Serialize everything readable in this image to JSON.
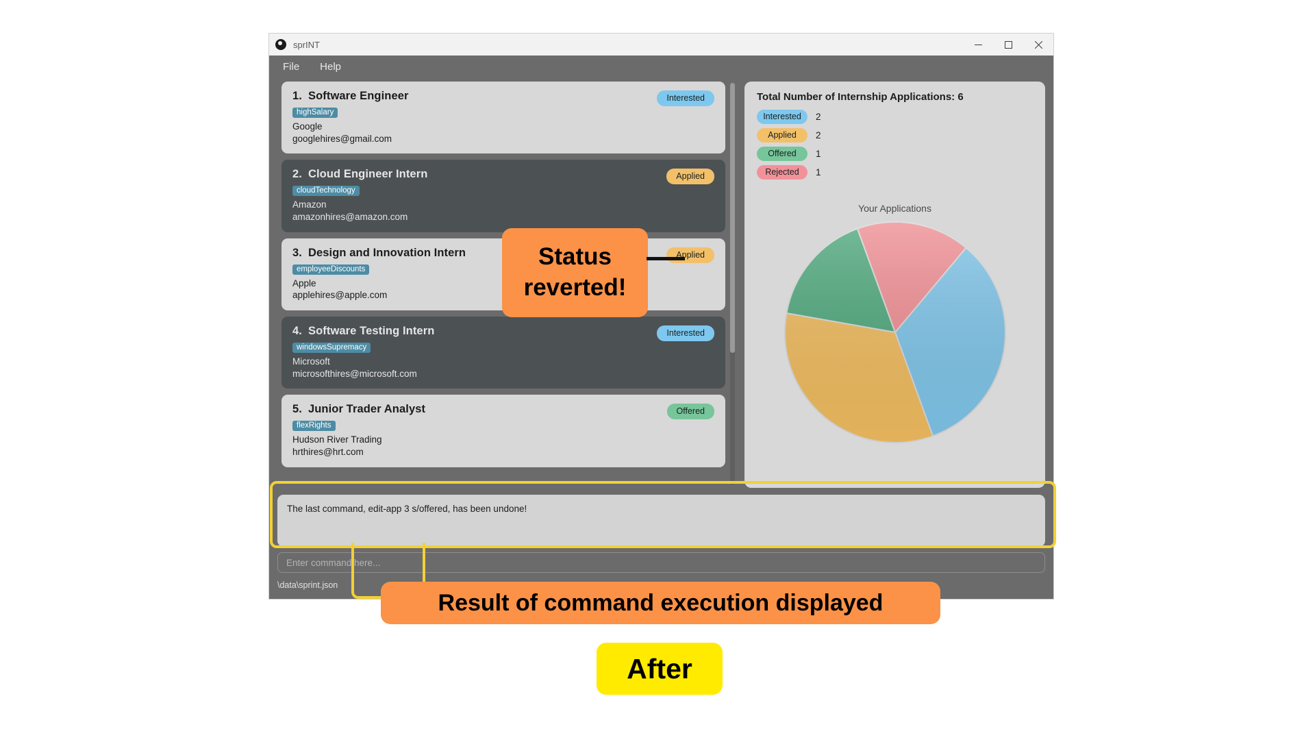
{
  "window": {
    "title": "sprINT",
    "logo_icon": "sprint-logo-icon",
    "controls": {
      "minimize": "minimize-icon",
      "maximize": "maximize-icon",
      "close": "close-icon"
    }
  },
  "menubar": {
    "items": [
      {
        "label": "File"
      },
      {
        "label": "Help"
      }
    ]
  },
  "applications": [
    {
      "index": "1.",
      "title": "Software Engineer",
      "tag": "highSalary",
      "company": "Google",
      "email": "googlehires@gmail.com",
      "status": "Interested",
      "status_class": "st-interested",
      "theme": "light"
    },
    {
      "index": "2.",
      "title": "Cloud Engineer Intern",
      "tag": "cloudTechnology",
      "company": "Amazon",
      "email": "amazonhires@amazon.com",
      "status": "Applied",
      "status_class": "st-applied",
      "theme": "dark"
    },
    {
      "index": "3.",
      "title": "Design and Innovation Intern",
      "tag": "employeeDiscounts",
      "company": "Apple",
      "email": "applehires@apple.com",
      "status": "Applied",
      "status_class": "st-applied",
      "theme": "light"
    },
    {
      "index": "4.",
      "title": "Software Testing Intern",
      "tag": "windowsSupremacy",
      "company": "Microsoft",
      "email": "microsofthires@microsoft.com",
      "status": "Interested",
      "status_class": "st-interested",
      "theme": "dark"
    },
    {
      "index": "5.",
      "title": "Junior Trader Analyst",
      "tag": "flexRights",
      "company": "Hudson River Trading",
      "email": "hrthires@hrt.com",
      "status": "Offered",
      "status_class": "st-offered",
      "theme": "light"
    }
  ],
  "stats": {
    "title": "Total Number of Internship Applications: 6",
    "total": 6,
    "rows": [
      {
        "label": "Interested",
        "count": "2",
        "class": "st-interested",
        "color": "#7ec8ef"
      },
      {
        "label": "Applied",
        "count": "2",
        "class": "st-applied",
        "color": "#f3c06a"
      },
      {
        "label": "Offered",
        "count": "1",
        "class": "st-offered",
        "color": "#77c59a"
      },
      {
        "label": "Rejected",
        "count": "1",
        "class": "st-rejected",
        "color": "#f2919a"
      }
    ]
  },
  "chart_data": {
    "type": "pie",
    "title": "Your Applications",
    "categories": [
      "Interested",
      "Applied",
      "Offered",
      "Rejected"
    ],
    "values": [
      2,
      2,
      1,
      1
    ],
    "colors": [
      "#7fc4e8",
      "#efbb5f",
      "#4fa87d",
      "#ef8e93"
    ],
    "total": 6,
    "legend": "left-panel",
    "start_angle_deg": -50
  },
  "result": {
    "text": "The last command, edit-app 3 s/offered, has been undone!"
  },
  "command": {
    "value": "",
    "placeholder": "Enter command here..."
  },
  "statusbar": {
    "path": "\\data\\sprint.json"
  },
  "annotations": {
    "status_callout": "Status reverted!",
    "result_callout": "Result of command execution displayed",
    "stage_badge": "After",
    "highlight_color": "#f2d037",
    "callout_color": "#fb9247",
    "badge_color": "#ffeb00"
  }
}
